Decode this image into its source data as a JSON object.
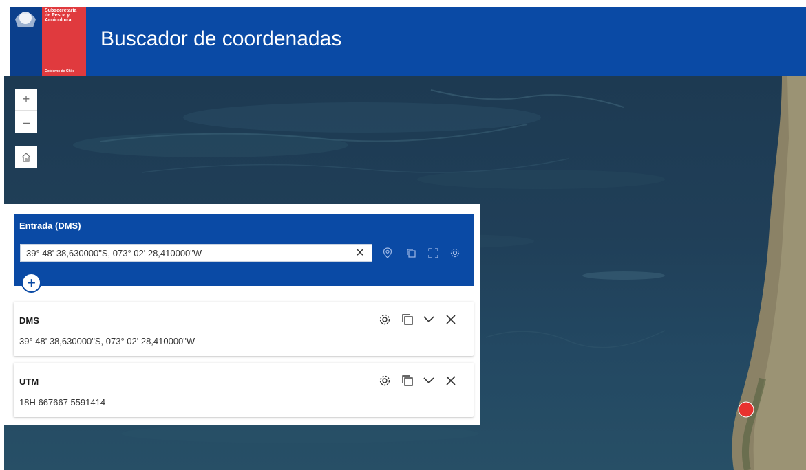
{
  "header": {
    "logo_lines": [
      "Subsecretaría",
      "de Pesca y",
      "Acuicultura"
    ],
    "logo_footer": "Gobierno de Chile",
    "title": "Buscador de coordenadas"
  },
  "map_controls": {
    "zoom_in_label": "+",
    "zoom_out_label": "–",
    "home_icon": "home-icon"
  },
  "input_panel": {
    "title": "Entrada (DMS)",
    "value": "39° 48' 38,630000\"S, 073° 02' 28,410000\"W",
    "clear_label": "×",
    "tool_icons": [
      "location-pin-icon",
      "copy-icon",
      "expand-icon",
      "gear-icon"
    ],
    "add_label": "+"
  },
  "results": [
    {
      "title": "DMS",
      "value": "39° 48' 38,630000\"S, 073° 02' 28,410000\"W"
    },
    {
      "title": "UTM",
      "value": "18H 667667 5591414"
    }
  ],
  "colors": {
    "header_blue": "#0a4aa5",
    "logo_red": "#e03a3e",
    "marker_red": "#e8322e",
    "ocean": "#1f3d56",
    "land": "#8b8266"
  }
}
